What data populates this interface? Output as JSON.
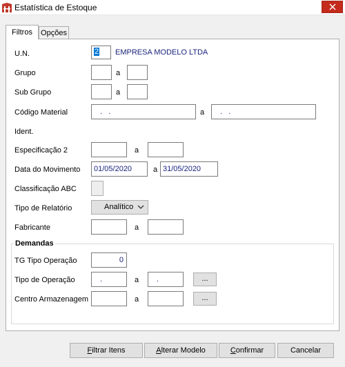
{
  "window": {
    "title": "Estatística de Estoque",
    "close_glyph": "✕"
  },
  "tabs": [
    {
      "label": "Filtros",
      "active": true
    },
    {
      "label": "Opções",
      "active": false
    }
  ],
  "form": {
    "un": {
      "label": "U.N.",
      "value": "2",
      "empresa": "EMPRESA MODELO LTDA"
    },
    "grupo": {
      "label": "Grupo",
      "from": "",
      "sep": "a",
      "to": ""
    },
    "sub_grupo": {
      "label": "Sub Grupo",
      "from": "",
      "sep": "a",
      "to": ""
    },
    "codigo_material": {
      "label": "Código Material",
      "from": "   .   .",
      "sep": "a",
      "to": "   .   ."
    },
    "ident": {
      "label": "Ident."
    },
    "especificacao2": {
      "label": "Especificação 2",
      "from": "",
      "sep": "a",
      "to": ""
    },
    "data_movimento": {
      "label": "Data do Movimento",
      "from": "01/05/2020",
      "sep": "a",
      "to": "31/05/2020"
    },
    "classificacao_abc": {
      "label": "Classificação ABC",
      "checked": false
    },
    "tipo_relatorio": {
      "label": "Tipo de Relatório",
      "value": "Analítico"
    },
    "fabricante": {
      "label": "Fabricante",
      "from": "",
      "sep": "a",
      "to": ""
    }
  },
  "demandas": {
    "title": "Demandas",
    "tg_tipo_operacao": {
      "label": "TG Tipo Operação",
      "value": "0"
    },
    "tipo_operacao": {
      "label": "Tipo de Operação",
      "from": ".",
      "sep": "a",
      "to": ".",
      "ellipsis": "..."
    },
    "centro_armazenagem": {
      "label": "Centro Armazenagem",
      "from": "",
      "sep": "a",
      "to": "",
      "ellipsis": "..."
    }
  },
  "buttons": [
    {
      "accel": "F",
      "rest": "iltrar Itens"
    },
    {
      "accel": "A",
      "rest": "lterar Modelo"
    },
    {
      "accel": "C",
      "rest": "onfirmar"
    },
    {
      "accel": "",
      "rest": "Cancelar"
    }
  ],
  "icons": {
    "app": "app-logo-icon",
    "close": "close-icon",
    "dropdown": "chevron-down-icon"
  },
  "colors": {
    "field_text": "#1a237e",
    "selection": "#0078d7",
    "close_button": "#c42b1c",
    "panel_bg": "#ffffff",
    "window_bg": "#f0f0f0"
  }
}
